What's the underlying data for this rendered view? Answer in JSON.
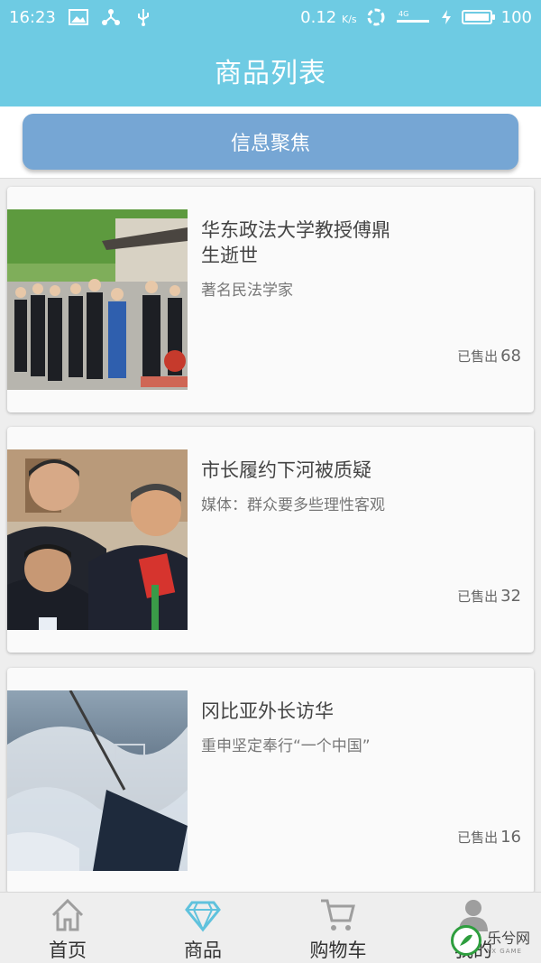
{
  "status_bar": {
    "time": "16:23",
    "speed_value": "0.12",
    "speed_unit": "K/s",
    "network": "4G",
    "battery": "100"
  },
  "app_bar": {
    "title": "商品列表"
  },
  "banner": {
    "label": "信息聚焦"
  },
  "products": [
    {
      "title": "华东政法大学教授傅鼎生逝世",
      "subtitle": "著名民法学家",
      "sold_label": "已售出",
      "sold_count": "68"
    },
    {
      "title": "市长履约下河被质疑",
      "subtitle": "媒体：群众要多些理性客观",
      "sold_label": "已售出",
      "sold_count": "32"
    },
    {
      "title": "冈比亚外长访华",
      "subtitle": "重申坚定奉行“一个中国”",
      "sold_label": "已售出",
      "sold_count": "16"
    }
  ],
  "bottom_nav": [
    {
      "label": "首页",
      "icon": "home-icon",
      "active": false
    },
    {
      "label": "商品",
      "icon": "diamond-icon",
      "active": true
    },
    {
      "label": "购物车",
      "icon": "cart-icon",
      "active": false
    },
    {
      "label": "我的",
      "icon": "user-icon",
      "active": false
    }
  ],
  "watermark": {
    "text": "乐兮网",
    "sub": "YX GAME"
  },
  "colors": {
    "primary": "#6ecbe3",
    "banner_button": "#76a6d4",
    "active_nav": "#5fc2dd",
    "inactive_nav": "#9e9e9e"
  }
}
